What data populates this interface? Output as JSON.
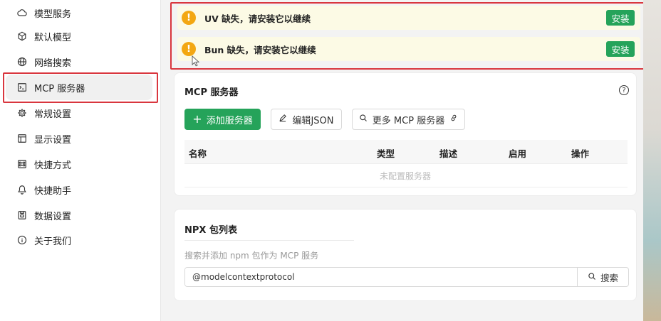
{
  "sidebar": {
    "items": [
      {
        "label": "模型服务",
        "icon": "cloud-icon"
      },
      {
        "label": "默认模型",
        "icon": "cube-icon"
      },
      {
        "label": "网络搜索",
        "icon": "globe-icon"
      },
      {
        "label": "MCP 服务器",
        "icon": "terminal-icon"
      },
      {
        "label": "常规设置",
        "icon": "gear-icon"
      },
      {
        "label": "显示设置",
        "icon": "layout-icon"
      },
      {
        "label": "快捷方式",
        "icon": "command-icon"
      },
      {
        "label": "快捷助手",
        "icon": "bell-icon"
      },
      {
        "label": "数据设置",
        "icon": "storage-icon"
      },
      {
        "label": "关于我们",
        "icon": "info-icon"
      }
    ],
    "active_index": 3
  },
  "alerts": [
    {
      "text": "UV 缺失，请安装它以继续",
      "button": "安装"
    },
    {
      "text": "Bun 缺失，请安装它以继续",
      "button": "安装"
    }
  ],
  "mcp": {
    "title": "MCP 服务器",
    "add_button": "添加服务器",
    "edit_json_button": "编辑JSON",
    "more_button": "更多 MCP 服务器",
    "columns": [
      "名称",
      "类型",
      "描述",
      "启用",
      "操作"
    ],
    "empty_text": "未配置服务器"
  },
  "npx": {
    "title": "NPX 包列表",
    "hint": "搜索并添加 npm 包作为 MCP 服务",
    "search_value": "@modelcontextprotocol",
    "search_button": "搜索"
  },
  "colors": {
    "accent": "#25a35a",
    "warning": "#f3a712",
    "alert_bg": "#fcfae5",
    "highlight": "#d9363e"
  }
}
